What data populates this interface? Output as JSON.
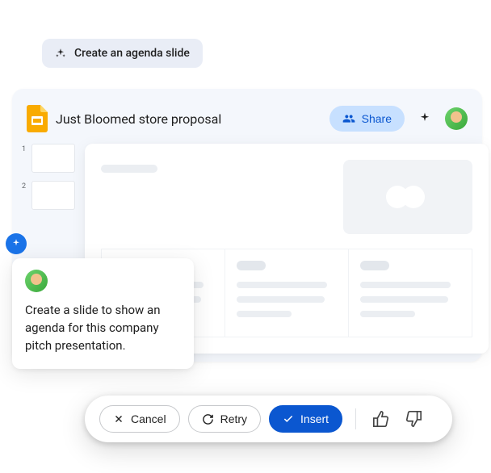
{
  "suggestion": {
    "label": "Create an agenda slide"
  },
  "app": {
    "title": "Just Bloomed store proposal",
    "share_label": "Share"
  },
  "thumbnails": [
    {
      "num": "1"
    },
    {
      "num": "2"
    }
  ],
  "prompt": {
    "text": "Create a slide to show an agenda for this company pitch presentation."
  },
  "actions": {
    "cancel": "Cancel",
    "retry": "Retry",
    "insert": "Insert"
  },
  "icons": {
    "sparkle": "sparkle-icon",
    "close": "close-icon",
    "refresh": "refresh-icon",
    "check": "check-icon",
    "people": "people-icon",
    "thumbs_up": "thumbs-up-icon",
    "thumbs_down": "thumbs-down-icon"
  },
  "colors": {
    "accent": "#0b57d0",
    "chip_bg": "#e9edf6",
    "share_bg": "#c7e0ff",
    "app_bg": "#f4f7fc"
  }
}
